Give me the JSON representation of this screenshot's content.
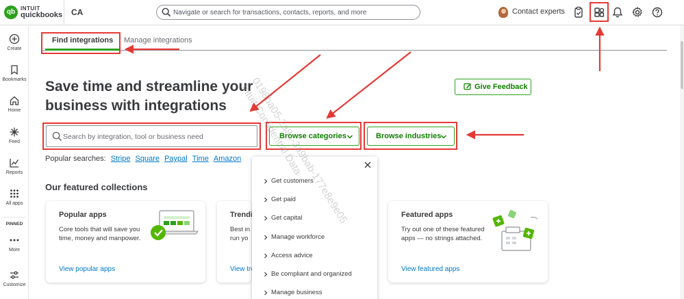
{
  "brand": {
    "intuit": "INTUIT",
    "product": "quickbooks",
    "mark": "qb"
  },
  "company": "CA",
  "search": {
    "placeholder": "Navigate or search for transactions, contacts, reports, and more"
  },
  "header": {
    "contact_label": "Contact experts",
    "icons": [
      "checklist-icon",
      "apps-icon",
      "bell-icon",
      "gear-icon",
      "help-icon"
    ]
  },
  "leftnav": {
    "items": [
      {
        "label": "Create",
        "icon": "plus-circle-icon"
      },
      {
        "label": "Bookmarks",
        "icon": "bookmark-icon"
      },
      {
        "label": "Home",
        "icon": "home-icon"
      },
      {
        "label": "Feed",
        "icon": "sparkle-icon"
      },
      {
        "label": "Reports",
        "icon": "chart-icon"
      },
      {
        "label": "All apps",
        "icon": "grid-icon"
      }
    ],
    "pinned_label": "PINNED",
    "more_label": "More",
    "customize_label": "Customize"
  },
  "tabs": [
    {
      "label": "Find integrations",
      "active": true
    },
    {
      "label": "Manage integrations",
      "active": false
    }
  ],
  "hero": {
    "line1": "Save time and streamline your",
    "line2": "business with integrations"
  },
  "feedback_label": "Give Feedback",
  "integration_search": {
    "placeholder": "Search by integration, tool or business need"
  },
  "browse_categories_label": "Browse categories",
  "browse_industries_label": "Browse industries",
  "popular": {
    "label": "Popular searches:",
    "links": [
      "Stripe",
      "Square",
      "Paypal",
      "Time",
      "Amazon"
    ]
  },
  "featured_title": "Our featured collections",
  "cards": [
    {
      "title": "Popular apps",
      "desc": "Core tools that will save you time, money and manpower.",
      "link": "View popular apps"
    },
    {
      "title": "Trendi",
      "desc": "Best in run yo",
      "link": "View tre"
    },
    {
      "title": "Featured apps",
      "desc": "Try out one of these featured apps — no strings attached.",
      "link": "View featured apps"
    }
  ],
  "dropdown": {
    "items": [
      "Get customers",
      "Get paid",
      "Get capital",
      "Manage workforce",
      "Access advice",
      "Be compliant and organized",
      "Manage business"
    ]
  },
  "watermark": {
    "line1": "0198ba05-2a8c-3a9bab-177e8e9e05",
    "line2": "Intuit Confidential Data"
  },
  "colors": {
    "brand_green": "#2ca01c",
    "link_blue": "#0077c5",
    "annotation_red": "#e53935"
  }
}
